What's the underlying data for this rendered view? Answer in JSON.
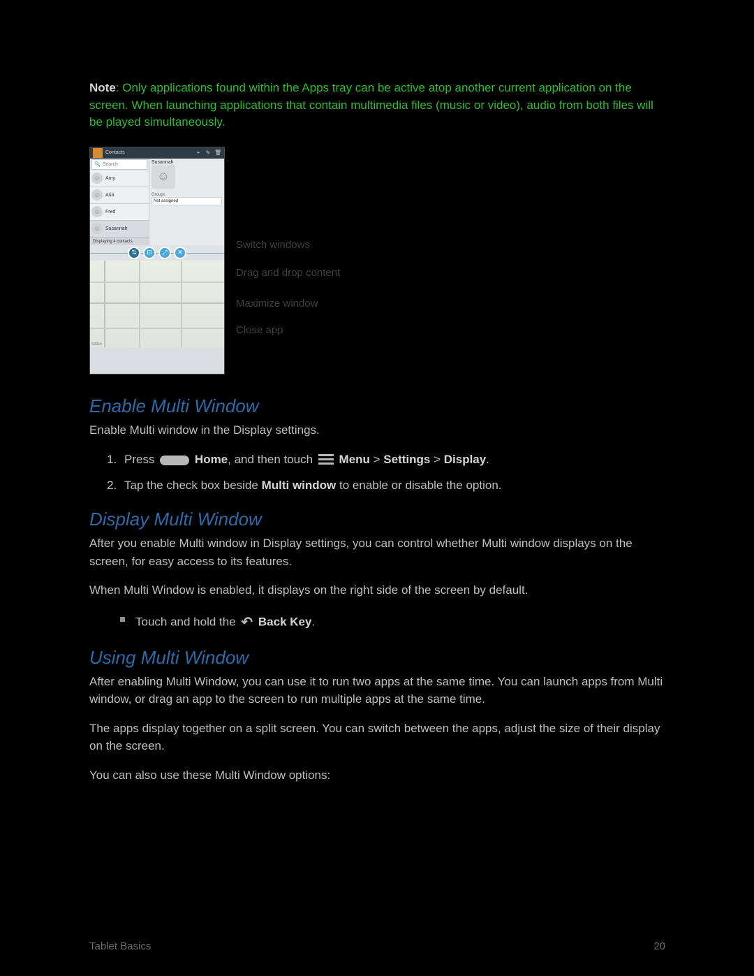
{
  "note": {
    "label": "Note",
    "text": ": Only applications found within the Apps tray can be active atop another current application on the screen. When launching applications that contain multimedia files (music or video), audio from both files will be played simultaneously."
  },
  "device": {
    "title": "Contacts",
    "search_placeholder": "Search",
    "contacts": [
      "Amy",
      "Aria",
      "Fred",
      "Susannah"
    ],
    "detail_name": "Susannah",
    "group_label": "Groups",
    "group_value": "Not assigned",
    "footer": "Displaying 4 contacts"
  },
  "callouts": {
    "switch": "Switch windows",
    "drag": "Drag and drop content",
    "max": "Maximize window",
    "close": "Close app"
  },
  "sections": {
    "enable": {
      "heading": "Enable Multi Window",
      "intro": "Enable Multi window in the Display settings.",
      "step1_a": "Press ",
      "step1_b": " Home",
      "step1_c": ", and then touch ",
      "step1_d": " Menu",
      "step1_e": " > ",
      "step1_f": "Settings",
      "step1_g": " > ",
      "step1_h": "Display",
      "step1_i": ".",
      "step2_a": "Tap the check box beside ",
      "step2_b": "Multi window",
      "step2_c": " to enable or disable the option."
    },
    "display": {
      "heading": "Display Multi Window",
      "p1": "After you enable Multi window in Display settings, you can control whether Multi window displays on the screen, for easy access to its features.",
      "p2": "When Multi Window is enabled, it displays on the right side of the screen by default.",
      "bullet_a": "Touch and hold the ",
      "bullet_b": " Back Key",
      "bullet_c": "."
    },
    "using": {
      "heading": "Using Multi Window",
      "p1": "After enabling Multi Window, you can use it to run two apps at the same time. You can launch apps from Multi window, or drag an app to the screen to run multiple apps at the same time.",
      "p2": "The apps display together on a split screen. You can switch between the apps, adjust the size of their display on the screen.",
      "p3": "You can also use these Multi Window options:"
    }
  },
  "footer": {
    "left": "Tablet Basics",
    "right": "20"
  }
}
